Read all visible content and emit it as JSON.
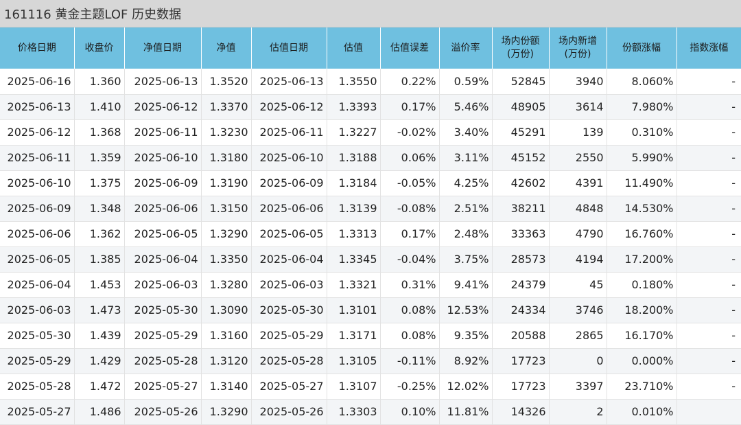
{
  "title": "161116 黄金主题LOF 历史数据",
  "headers": [
    {
      "label": "价格日期"
    },
    {
      "label": "收盘价"
    },
    {
      "label": "净值日期"
    },
    {
      "label": "净值"
    },
    {
      "label": "估值日期"
    },
    {
      "label": "估值"
    },
    {
      "label": "估值误差"
    },
    {
      "label": "溢价率"
    },
    {
      "label": "场内份额",
      "sub": "(万份)"
    },
    {
      "label": "场内新增",
      "sub": "(万份)"
    },
    {
      "label": "份额涨幅"
    },
    {
      "label": "指数涨幅"
    }
  ],
  "rows": [
    [
      "2025-06-16",
      "1.360",
      "2025-06-13",
      "1.3520",
      "2025-06-13",
      "1.3550",
      "0.22%",
      "0.59%",
      "52845",
      "3940",
      "8.060%",
      "-"
    ],
    [
      "2025-06-13",
      "1.410",
      "2025-06-12",
      "1.3370",
      "2025-06-12",
      "1.3393",
      "0.17%",
      "5.46%",
      "48905",
      "3614",
      "7.980%",
      "-"
    ],
    [
      "2025-06-12",
      "1.368",
      "2025-06-11",
      "1.3230",
      "2025-06-11",
      "1.3227",
      "-0.02%",
      "3.40%",
      "45291",
      "139",
      "0.310%",
      "-"
    ],
    [
      "2025-06-11",
      "1.359",
      "2025-06-10",
      "1.3180",
      "2025-06-10",
      "1.3188",
      "0.06%",
      "3.11%",
      "45152",
      "2550",
      "5.990%",
      "-"
    ],
    [
      "2025-06-10",
      "1.375",
      "2025-06-09",
      "1.3190",
      "2025-06-09",
      "1.3184",
      "-0.05%",
      "4.25%",
      "42602",
      "4391",
      "11.490%",
      "-"
    ],
    [
      "2025-06-09",
      "1.348",
      "2025-06-06",
      "1.3150",
      "2025-06-06",
      "1.3139",
      "-0.08%",
      "2.51%",
      "38211",
      "4848",
      "14.530%",
      "-"
    ],
    [
      "2025-06-06",
      "1.362",
      "2025-06-05",
      "1.3290",
      "2025-06-05",
      "1.3313",
      "0.17%",
      "2.48%",
      "33363",
      "4790",
      "16.760%",
      "-"
    ],
    [
      "2025-06-05",
      "1.385",
      "2025-06-04",
      "1.3350",
      "2025-06-04",
      "1.3345",
      "-0.04%",
      "3.75%",
      "28573",
      "4194",
      "17.200%",
      "-"
    ],
    [
      "2025-06-04",
      "1.453",
      "2025-06-03",
      "1.3280",
      "2025-06-03",
      "1.3321",
      "0.31%",
      "9.41%",
      "24379",
      "45",
      "0.180%",
      "-"
    ],
    [
      "2025-06-03",
      "1.473",
      "2025-05-30",
      "1.3090",
      "2025-05-30",
      "1.3101",
      "0.08%",
      "12.53%",
      "24334",
      "3746",
      "18.200%",
      "-"
    ],
    [
      "2025-05-30",
      "1.439",
      "2025-05-29",
      "1.3160",
      "2025-05-29",
      "1.3171",
      "0.08%",
      "9.35%",
      "20588",
      "2865",
      "16.170%",
      "-"
    ],
    [
      "2025-05-29",
      "1.429",
      "2025-05-28",
      "1.3120",
      "2025-05-28",
      "1.3105",
      "-0.11%",
      "8.92%",
      "17723",
      "0",
      "0.000%",
      "-"
    ],
    [
      "2025-05-28",
      "1.472",
      "2025-05-27",
      "1.3140",
      "2025-05-27",
      "1.3107",
      "-0.25%",
      "12.02%",
      "17723",
      "3397",
      "23.710%",
      "-"
    ],
    [
      "2025-05-27",
      "1.486",
      "2025-05-26",
      "1.3290",
      "2025-05-26",
      "1.3303",
      "0.10%",
      "11.81%",
      "14326",
      "2",
      "0.010%",
      ""
    ]
  ],
  "colors": {
    "title_bg": "#d7d7d7",
    "header_bg": "#6fc0e0",
    "row_alt_bg": "#f3f5f7",
    "grid": "#e2e2e2"
  }
}
